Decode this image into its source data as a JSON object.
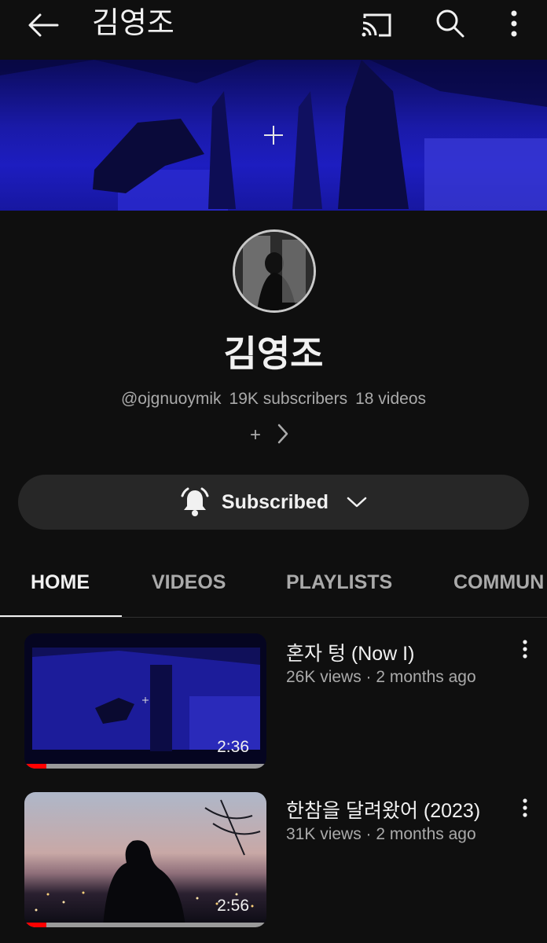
{
  "header": {
    "title": "김영조",
    "icons": [
      "back-arrow-icon",
      "cast-icon",
      "search-icon",
      "more-vert-icon"
    ]
  },
  "channel": {
    "name": "김영조",
    "handle": "@ojgnuoymik",
    "subscribers": "19K subscribers",
    "videos_count": "18 videos",
    "links_plus": "+"
  },
  "subscribe": {
    "label": "Subscribed"
  },
  "tabs": [
    {
      "label": "HOME"
    },
    {
      "label": "VIDEOS"
    },
    {
      "label": "PLAYLISTS"
    },
    {
      "label": "COMMUN"
    }
  ],
  "videos": [
    {
      "title": "혼자 텅 (Now I)",
      "meta": "26K views · 2 months ago",
      "duration": "2:36",
      "watched_fraction": 0.09
    },
    {
      "title": "한참을 달려왔어 (2023)",
      "meta": "31K views · 2 months ago",
      "duration": "2:56",
      "watched_fraction": 0.09
    }
  ],
  "colors": {
    "background": "#0f0f0f",
    "progress": "#ff0000",
    "banner": "#1d1dc0"
  }
}
